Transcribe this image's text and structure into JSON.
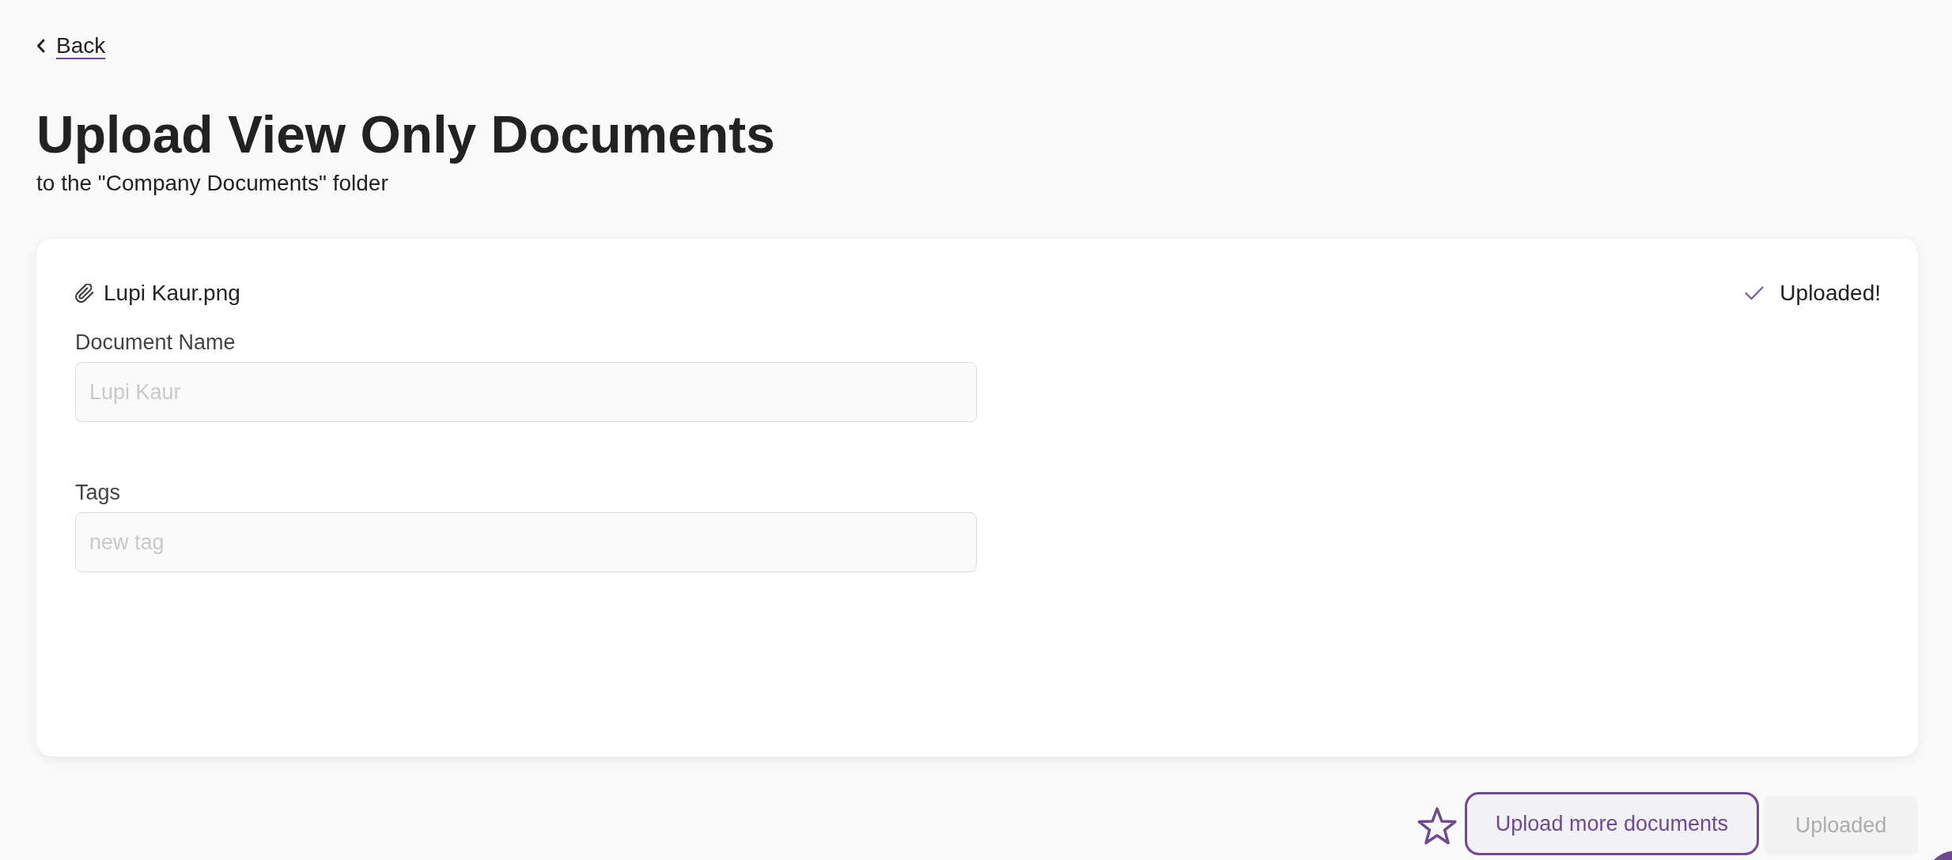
{
  "back_link": {
    "label": "Back"
  },
  "header": {
    "title": "Upload View Only Documents",
    "subtitle": "to the \"Company Documents\" folder"
  },
  "upload_card": {
    "file_name": "Lupi Kaur.png",
    "status": "Uploaded!",
    "fields": [
      {
        "label": "Document Name",
        "placeholder": "Lupi Kaur"
      },
      {
        "label": "Tags",
        "placeholder": "new tag"
      }
    ]
  },
  "actions": {
    "starred": false,
    "buttons": [
      {
        "label": "Upload more documents",
        "kind": "outline",
        "disabled": false
      },
      {
        "label": "Uploaded",
        "kind": "plain",
        "disabled": true
      }
    ]
  }
}
